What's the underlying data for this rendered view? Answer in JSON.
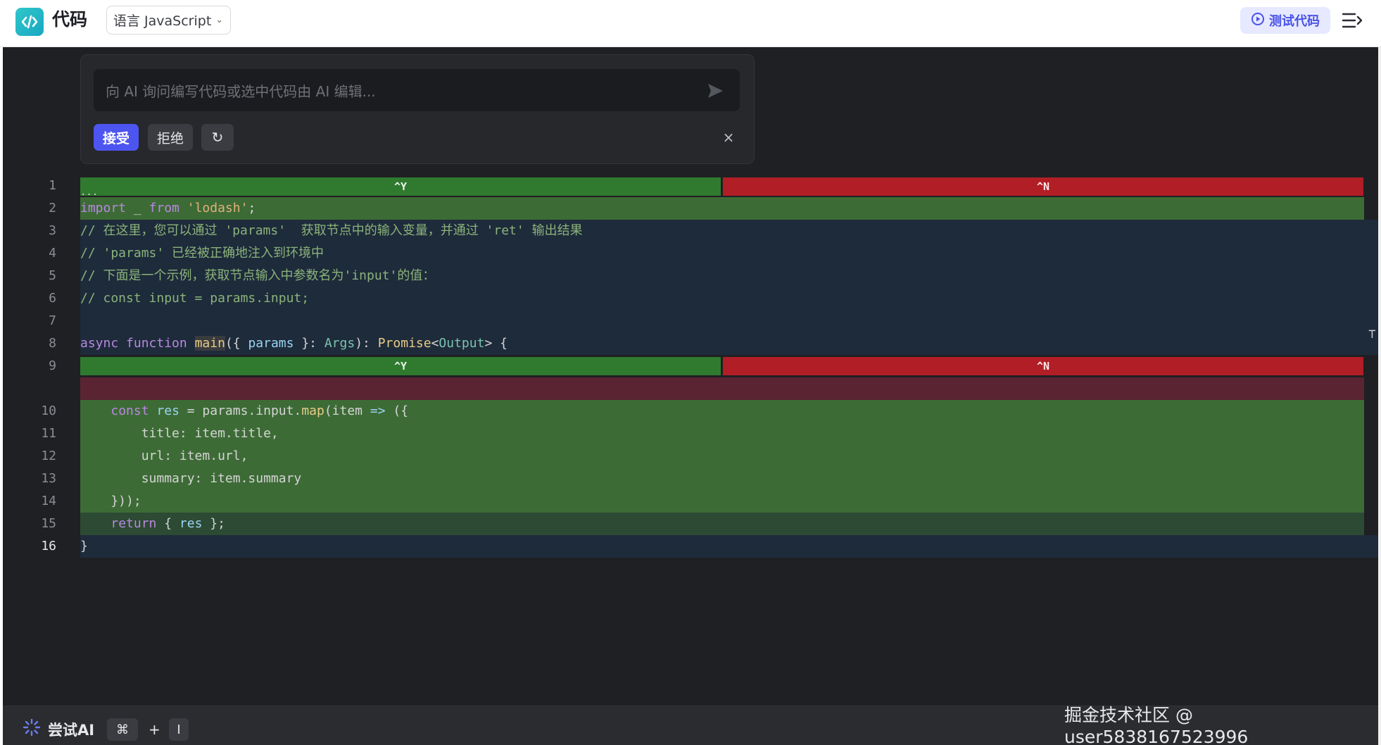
{
  "header": {
    "title": "代码",
    "language_select": "语言 JavaScript",
    "test_button": "测试代码",
    "logo_icon": "code-brackets-icon",
    "menu_icon": "collapse-menu-icon",
    "accent": "#4a53e6"
  },
  "ai_panel": {
    "placeholder": "向 AI 询问编写代码或选中代码由 AI 编辑...",
    "accept": "接受",
    "reject": "拒绝",
    "regenerate_icon": "↻",
    "close_icon": "×"
  },
  "diff": {
    "accept_shortcut": "^Y",
    "reject_shortcut": "^N",
    "ellipsis": "..."
  },
  "line_numbers": [
    "1",
    "2",
    "3",
    "4",
    "5",
    "6",
    "7",
    "8",
    "9",
    "10",
    "11",
    "12",
    "13",
    "14",
    "15",
    "16"
  ],
  "code": {
    "l2": {
      "a": "import",
      "b": " _ ",
      "c": "from",
      "d": " ",
      "e": "'lodash'",
      "f": ";"
    },
    "l3": "// 在这里，您可以通过 'params'  获取节点中的输入变量，并通过 'ret' 输出结果",
    "l4": "// 'params' 已经被正确地注入到环境中",
    "l5": "// 下面是一个示例，获取节点输入中参数名为'input'的值：",
    "l6": "// const input = params.input;",
    "l8": {
      "a": "async",
      "b": " ",
      "c": "function",
      "d": " ",
      "e": "main",
      "f": "({ ",
      "g": "params",
      "h": " }: ",
      "i": "Args",
      "j": "): ",
      "k": "Promise",
      "l": "<",
      "m": "Output",
      "n": "> {"
    },
    "l10": {
      "a": "    ",
      "b": "const",
      "c": " ",
      "d": "res",
      "e": " = ",
      "f": "params",
      "g": ".input.",
      "h": "map",
      "i": "(",
      "j": "item",
      "k": " => ",
      "l": "({"
    },
    "l11": "        title: item.title,",
    "l12": "        url: item.url,",
    "l13": "        summary: item.summary",
    "l14": "    }));",
    "l15": {
      "a": "    ",
      "b": "return",
      "c": " { ",
      "d": "res",
      "e": " };"
    },
    "l16": "}"
  },
  "footer": {
    "try_ai": "尝试AI",
    "key_cmd": "⌘",
    "plus": "+",
    "key_i": "I",
    "sparkle_icon": "sparkle-icon"
  },
  "watermark": "掘金技术社区 @ user5838167523996"
}
